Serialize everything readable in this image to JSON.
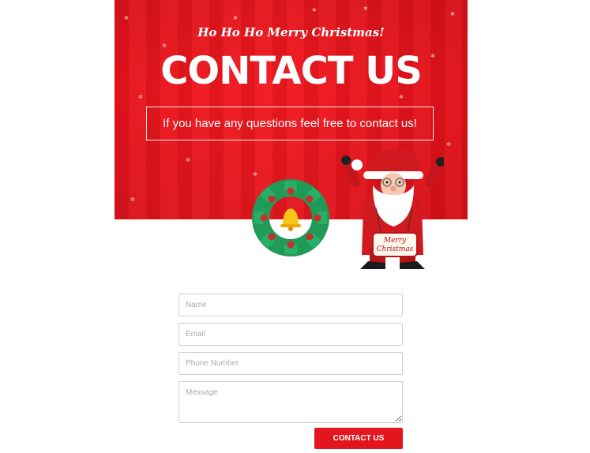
{
  "hero": {
    "greeting": "Ho Ho Ho Merry Christmas!",
    "title": "CONTACT US",
    "subtitle": "If you have any questions feel free to contact us!"
  },
  "illustration": {
    "santa_sign": "Merry Christmas"
  },
  "form": {
    "name_placeholder": "Name",
    "email_placeholder": "Email",
    "phone_placeholder": "Phone Number",
    "message_placeholder": "Message",
    "submit_label": "CONTACT US"
  },
  "colors": {
    "brand_red": "#e4161d",
    "wreath_green": "#1f9a57",
    "bell_yellow": "#f5c518"
  }
}
